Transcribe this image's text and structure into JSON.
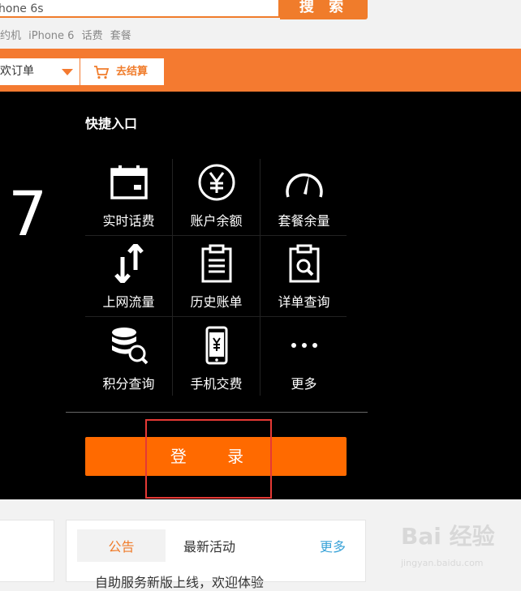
{
  "search": {
    "value": "hone 6s",
    "button_label": "搜 索"
  },
  "hot_words": [
    "约机",
    "iPhone 6",
    "话费",
    "套餐"
  ],
  "header": {
    "order_label": "欢订单",
    "cart_label": "去结算"
  },
  "hero": {
    "big_text": "7"
  },
  "quick": {
    "title": "快捷入口",
    "items": [
      {
        "label": "实时话费",
        "icon": "calendar-icon"
      },
      {
        "label": "账户余额",
        "icon": "yuan-circle-icon"
      },
      {
        "label": "套餐余量",
        "icon": "gauge-icon"
      },
      {
        "label": "上网流量",
        "icon": "up-down-arrows-icon"
      },
      {
        "label": "历史账单",
        "icon": "clipboard-icon"
      },
      {
        "label": "详单查询",
        "icon": "clipboard-search-icon"
      },
      {
        "label": "积分查询",
        "icon": "database-search-icon"
      },
      {
        "label": "手机交费",
        "icon": "phone-yuan-icon"
      },
      {
        "label": "更多",
        "icon": "more-dots-icon"
      }
    ]
  },
  "login": {
    "label": "登 录"
  },
  "news": {
    "tabs": [
      {
        "label": "公告"
      },
      {
        "label": "最新活动"
      }
    ],
    "more_label": "更多",
    "first_item": "自助服务新版上线，欢迎体验"
  },
  "colors": {
    "accent": "#f47a30",
    "login": "#ff6a00",
    "highlight": "#e53935",
    "link": "#3aa3d8"
  },
  "watermark": {
    "logo": "Bai 经验",
    "url": "jingyan.baidu.com"
  }
}
